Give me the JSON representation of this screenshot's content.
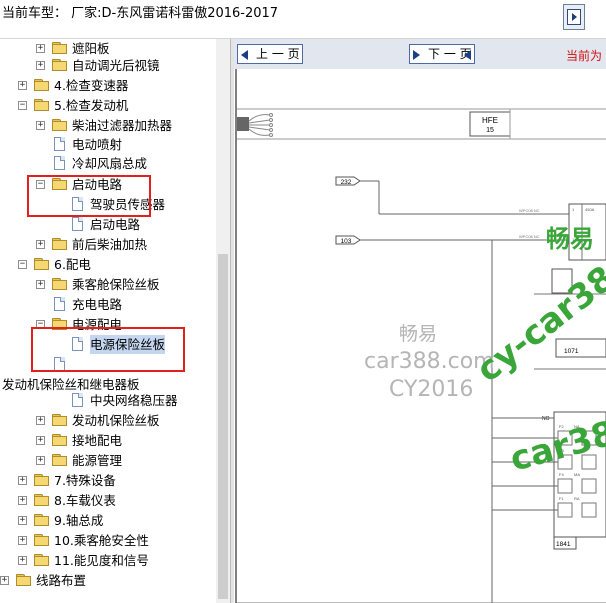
{
  "window": {
    "title": "当前车型： 厂家:D-东风雷诺科雷傲2016-2017",
    "exit_icon": "exit-door-icon"
  },
  "tree": {
    "items": [
      {
        "label": "遮阳板",
        "expander": "+",
        "icon": "folder-icon"
      },
      {
        "label": "自动调光后视镜",
        "expander": "+",
        "icon": "folder-icon"
      },
      {
        "label": "4.检查变速器",
        "expander": "+",
        "icon": "folder-icon"
      },
      {
        "label": "5.检查发动机",
        "expander": "−",
        "icon": "folder-open-icon"
      },
      {
        "label": "柴油过滤器加热器",
        "expander": "+",
        "icon": "folder-icon"
      },
      {
        "label": "电动喷射",
        "expander": "",
        "icon": "document-icon"
      },
      {
        "label": "冷却风扇总成",
        "expander": "",
        "icon": "document-icon"
      },
      {
        "label": "启动电路",
        "expander": "−",
        "icon": "folder-open-icon"
      },
      {
        "label": "驾驶员传感器",
        "expander": "",
        "icon": "document-icon"
      },
      {
        "label": "启动电路",
        "expander": "",
        "icon": "document-icon"
      },
      {
        "label": "前后柴油加热",
        "expander": "+",
        "icon": "folder-icon"
      },
      {
        "label": "6.配电",
        "expander": "−",
        "icon": "folder-open-icon"
      },
      {
        "label": "乘客舱保险丝板",
        "expander": "+",
        "icon": "folder-icon"
      },
      {
        "label": "充电电路",
        "expander": "",
        "icon": "document-icon"
      },
      {
        "label": "电源配电",
        "expander": "−",
        "icon": "folder-open-icon"
      },
      {
        "label": "电源保险丝板",
        "expander": "",
        "icon": "document-icon"
      },
      {
        "label": "",
        "expander": "",
        "icon": "document-icon"
      },
      {
        "label": "发动机保险丝和继电器板",
        "expander": "",
        "icon": ""
      },
      {
        "label": "中央网络稳压器",
        "expander": "",
        "icon": "document-icon"
      },
      {
        "label": "发动机保险丝板",
        "expander": "+",
        "icon": "folder-icon"
      },
      {
        "label": "接地配电",
        "expander": "+",
        "icon": "folder-icon"
      },
      {
        "label": "能源管理",
        "expander": "+",
        "icon": "folder-icon"
      },
      {
        "label": "7.特殊设备",
        "expander": "+",
        "icon": "folder-icon"
      },
      {
        "label": "8.车载仪表",
        "expander": "+",
        "icon": "folder-icon"
      },
      {
        "label": "9.轴总成",
        "expander": "+",
        "icon": "folder-icon"
      },
      {
        "label": "10.乘客舱安全性",
        "expander": "+",
        "icon": "folder-icon"
      },
      {
        "label": "11.能见度和信号",
        "expander": "+",
        "icon": "folder-icon"
      },
      {
        "label": "线路布置",
        "expander": "+",
        "icon": "folder-icon"
      }
    ],
    "selected_label": "电源保险丝板"
  },
  "viewer": {
    "prev_label": "上 一 页",
    "next_label": "下 一 页",
    "page_info": "当前为",
    "diagram": {
      "connector_label": "HFE",
      "connector_number": "15",
      "tag_232": "232",
      "tag_103": "103",
      "block_1071": "1071",
      "block_1841": "1841",
      "no_label": "NO"
    },
    "watermarks": {
      "w1": "畅易",
      "w2": "car388.com",
      "w3": "CY2016",
      "w4": "cy-car388",
      "w5": "畅易",
      "w6": "car38"
    },
    "colors": {
      "watermark_green": "#3aa63a",
      "watermark_gray": "#b5b5b5",
      "highlight_red": "#e22020",
      "selection_blue": "#c5d7f0"
    }
  }
}
